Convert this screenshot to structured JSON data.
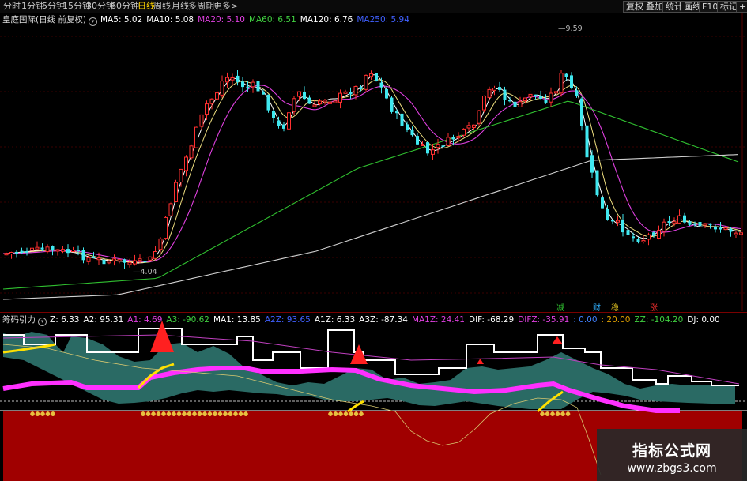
{
  "toolbar": {
    "periods": [
      {
        "label": "分时"
      },
      {
        "label": "1分钟"
      },
      {
        "label": "5分钟"
      },
      {
        "label": "15分钟"
      },
      {
        "label": "30分钟"
      },
      {
        "label": "60分钟"
      },
      {
        "label": "日线",
        "active": true
      },
      {
        "label": "周线"
      },
      {
        "label": "月线"
      },
      {
        "label": "多周期"
      },
      {
        "label": "更多>"
      }
    ],
    "right_buttons": [
      {
        "label": "复权"
      },
      {
        "label": "叠加"
      },
      {
        "label": "统计"
      },
      {
        "label": "画线"
      },
      {
        "label": "F10"
      },
      {
        "label": "标记"
      },
      {
        "label": "+自"
      }
    ]
  },
  "main_legend": {
    "title": "皇庭国际(日线 前复权)",
    "items": [
      {
        "label": "MA5: 5.02",
        "color": "#ffffff"
      },
      {
        "label": "MA10: 5.08",
        "color": "#ffffff"
      },
      {
        "label": "MA20: 5.10",
        "color": "#e040e0"
      },
      {
        "label": "MA60: 6.51",
        "color": "#40d040"
      },
      {
        "label": "MA120: 6.76",
        "color": "#ffffff"
      },
      {
        "label": "MA250: 5.94",
        "color": "#4060ff"
      }
    ]
  },
  "price_labels": {
    "high": "9.59",
    "low": "4.04"
  },
  "signals": [
    {
      "label": "减",
      "color": "#30c030"
    },
    {
      "label": "财",
      "color": "#30b0ff"
    },
    {
      "label": "稳",
      "color": "#e0c020"
    },
    {
      "label": "涨",
      "color": "#ff3030"
    }
  ],
  "indicator_legend": {
    "title": "筹码引力",
    "items": [
      {
        "label": "Z: 6.33",
        "color": "#ffffff"
      },
      {
        "label": "A2: 95.31",
        "color": "#ffffff"
      },
      {
        "label": "A1: 4.69",
        "color": "#e040e0"
      },
      {
        "label": "A3: -90.62",
        "color": "#40d040"
      },
      {
        "label": "MA1: 13.85",
        "color": "#ffffff"
      },
      {
        "label": "A2Z: 93.65",
        "color": "#4060ff"
      },
      {
        "label": "A1Z: 6.33",
        "color": "#ffffff"
      },
      {
        "label": "A3Z: -87.34",
        "color": "#ffffff"
      },
      {
        "label": "MA1Z: 24.41",
        "color": "#e040e0"
      },
      {
        "label": "DIF: -68.29",
        "color": "#ffffff"
      },
      {
        "label": "DIFZ: -35.91",
        "color": "#e040e0"
      },
      {
        "label": ": 0.00",
        "color": "#4080ff"
      },
      {
        "label": ": 20.00",
        "color": "#e0a000"
      },
      {
        "label": "ZZ: -104.20",
        "color": "#40d040"
      },
      {
        "label": "DJ: 0.00",
        "color": "#ffffff"
      }
    ]
  },
  "colors": {
    "up_candle": "#ff3030",
    "down_candle": "#40e8f0",
    "ma5": "#ffffff",
    "ma10": "#f0e080",
    "ma20": "#e040e0",
    "ma60": "#30c030",
    "ma120": "#d0d0d0",
    "chip_area": "#2a6a64",
    "base_red": "#a00000",
    "magenta_band": "#ff30ff",
    "yellow_line": "#ffe000"
  },
  "watermark": {
    "name": "指标公式网",
    "url": "www.zbgs3.com"
  }
}
